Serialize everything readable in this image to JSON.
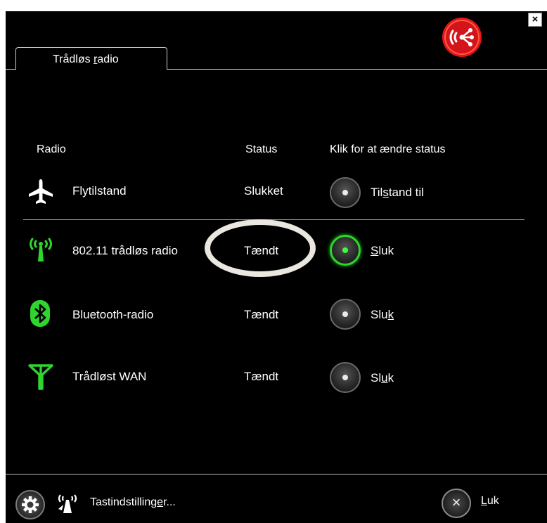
{
  "window": {
    "close_glyph": "×",
    "tab": {
      "before": "Trådløs ",
      "underline": "r",
      "after": "adio"
    }
  },
  "table": {
    "headers": {
      "radio": "Radio",
      "status": "Status",
      "action": "Klik for at ændre status"
    },
    "rows": [
      {
        "icon": "airplane-icon",
        "name": "Flytilstand",
        "status": "Slukket",
        "state": "off",
        "action": {
          "before": "Til",
          "underline": "s",
          "after": "tand til"
        }
      },
      {
        "icon": "wifi-antenna-icon",
        "name": "802.11 trådløs radio",
        "status": "Tændt",
        "state": "on",
        "action": {
          "before": "",
          "underline": "S",
          "after": "luk"
        }
      },
      {
        "icon": "bluetooth-icon",
        "name": "Bluetooth-radio",
        "status": "Tændt",
        "state": "off",
        "action": {
          "before": "Slu",
          "underline": "k",
          "after": ""
        }
      },
      {
        "icon": "wan-antenna-icon",
        "name": "Trådløst WAN",
        "status": "Tændt",
        "state": "off",
        "action": {
          "before": "Sl",
          "underline": "u",
          "after": "k"
        }
      }
    ]
  },
  "footer": {
    "settings": {
      "before": "Tastindstilling",
      "underline": "e",
      "after": "r..."
    },
    "close": {
      "before": "",
      "underline": "L",
      "after": "uk"
    },
    "close_glyph": "×"
  },
  "colors": {
    "accent_green": "#2fd52f",
    "logo_red": "#e5141b",
    "background": "#000000",
    "highlight": "#e9e7df"
  }
}
